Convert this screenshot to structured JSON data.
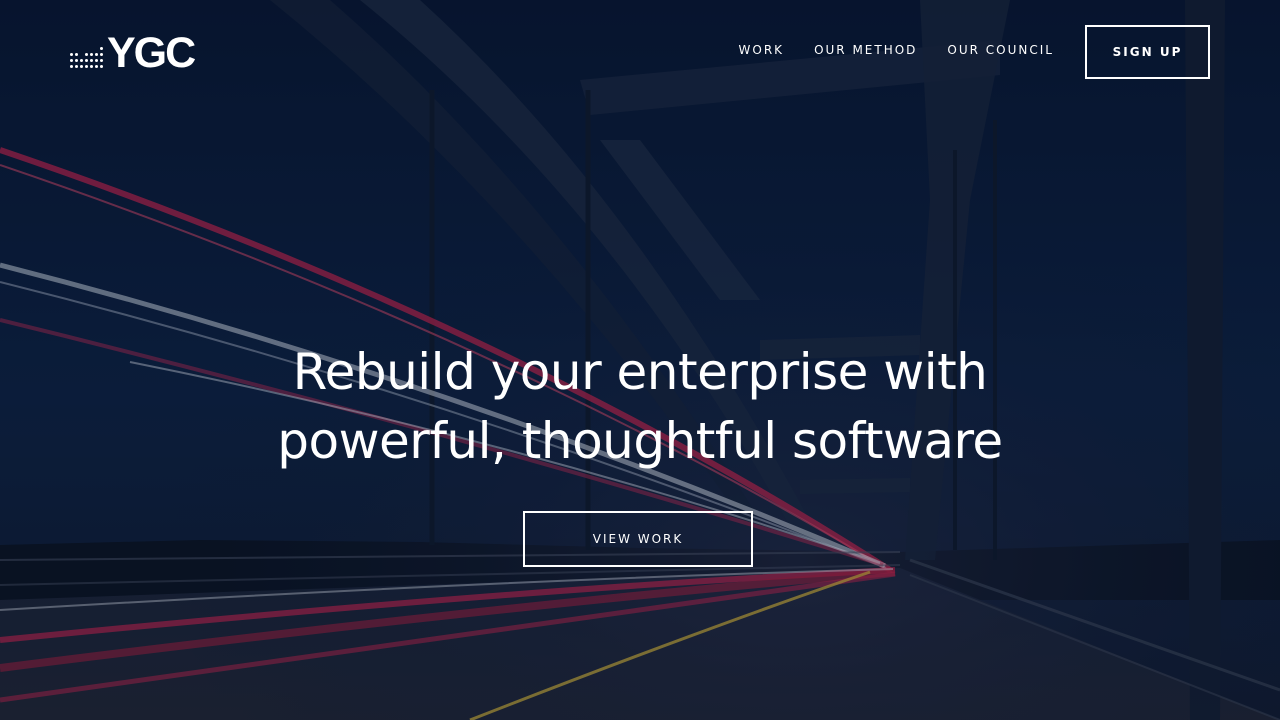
{
  "nav": {
    "logo_text": "YGC",
    "links": [
      {
        "label": "WORK"
      },
      {
        "label": "OUR METHOD"
      },
      {
        "label": "OUR COUNCIL"
      }
    ],
    "signup_label": "SIGN UP"
  },
  "hero": {
    "headline_line1": "Rebuild your enterprise with",
    "headline_line2": "powerful, thoughtful software",
    "cta_label": "VIEW WORK",
    "background_image": "night-bridge-light-trails"
  },
  "colors": {
    "text": "#ffffff",
    "sky": "#0b1f3d",
    "trail_red": "#c8244e",
    "trail_white": "#e8eef6",
    "trail_yellow": "#d6b43a"
  }
}
